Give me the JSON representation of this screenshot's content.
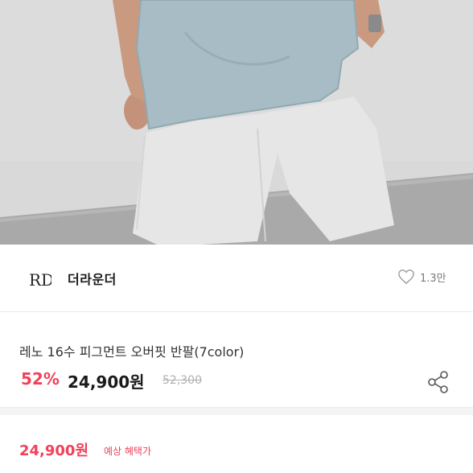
{
  "brand": {
    "name": "더라운더",
    "logo_text": "RD",
    "like_count": "1.3만"
  },
  "product": {
    "name": "레노 16수 피그먼트 오버핏 반팔(7color)",
    "discount": "52%",
    "price": "24,900원",
    "original_price": "52,300"
  },
  "benefit": {
    "price": "24,900원",
    "label": "예상 혜택가"
  },
  "colors": {
    "accent": "#f0415a",
    "shirt": "#9fb4bd",
    "pants": "#e2e2e2"
  }
}
